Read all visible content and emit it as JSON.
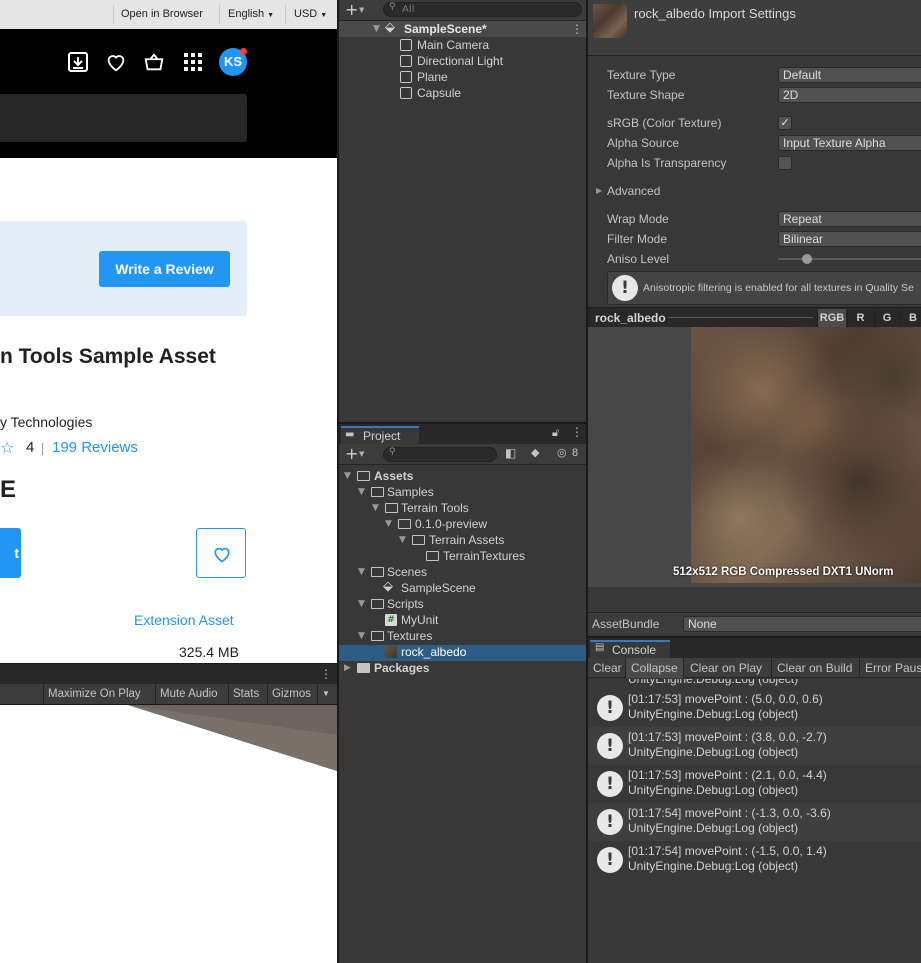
{
  "store": {
    "topbar": {
      "open_in_browser": "Open in Browser",
      "language": "English",
      "currency": "USD"
    },
    "avatar_initials": "KS",
    "review_button": "Write a Review",
    "asset_title": "n Tools Sample Asset",
    "publisher": "y Technologies",
    "star": "☆",
    "rating": "4",
    "reviews": "199 Reviews",
    "price": "E",
    "add_button": "t",
    "extension_asset": "Extension Asset",
    "file_size": "325.4 MB"
  },
  "game_view": {
    "toolbar": {
      "maximize": "Maximize On Play",
      "mute": "Mute Audio",
      "stats": "Stats",
      "gizmos": "Gizmos"
    }
  },
  "hierarchy": {
    "search_placeholder": "All",
    "scene": "SampleScene*",
    "items": [
      "Main Camera",
      "Directional Light",
      "Plane",
      "Capsule"
    ]
  },
  "project": {
    "tab_label": "Project",
    "hidden_count": "8",
    "tree": {
      "assets": "Assets",
      "samples": "Samples",
      "terrain_tools": "Terrain Tools",
      "version": "0.1.0-preview",
      "terrain_assets": "Terrain Assets",
      "terrain_textures": "TerrainTextures",
      "scenes": "Scenes",
      "sample_scene": "SampleScene",
      "scripts": "Scripts",
      "my_unit": "MyUnit",
      "textures": "Textures",
      "rock_albedo": "rock_albedo",
      "packages": "Packages"
    }
  },
  "inspector": {
    "title": "rock_albedo Import Settings",
    "props": {
      "texture_type_label": "Texture Type",
      "texture_type_value": "Default",
      "texture_shape_label": "Texture Shape",
      "texture_shape_value": "2D",
      "srgb_label": "sRGB (Color Texture)",
      "srgb_check": "✓",
      "alpha_source_label": "Alpha Source",
      "alpha_source_value": "Input Texture Alpha",
      "alpha_transp_label": "Alpha Is Transparency",
      "advanced_label": "Advanced",
      "wrap_mode_label": "Wrap Mode",
      "wrap_mode_value": "Repeat",
      "filter_mode_label": "Filter Mode",
      "filter_mode_value": "Bilinear",
      "aniso_label": "Aniso Level",
      "aniso_level": 1
    },
    "help_text": "Anisotropic filtering is enabled for all textures in Quality Se",
    "preview": {
      "name": "rock_albedo",
      "channels": [
        "RGB",
        "R",
        "G",
        "B"
      ],
      "info": "512x512  RGB Compressed DXT1 UNorm"
    },
    "assetbundle_label": "AssetBundle",
    "assetbundle_value": "None"
  },
  "console": {
    "tab_label": "Console",
    "toolbar": {
      "clear": "Clear",
      "collapse": "Collapse",
      "clear_on_play": "Clear on Play",
      "clear_on_build": "Clear on Build",
      "error_pause": "Error Paus"
    },
    "partial_top": "UnityEngine.Debug:Log (object)",
    "logs": [
      {
        "msg": "[01:17:53] movePoint : (5.0, 0.0, 0.6)",
        "src": "UnityEngine.Debug:Log (object)"
      },
      {
        "msg": "[01:17:53] movePoint : (3.8, 0.0, -2.7)",
        "src": "UnityEngine.Debug:Log (object)"
      },
      {
        "msg": "[01:17:53] movePoint : (2.1, 0.0, -4.4)",
        "src": "UnityEngine.Debug:Log (object)"
      },
      {
        "msg": "[01:17:54] movePoint : (-1.3, 0.0, -3.6)",
        "src": "UnityEngine.Debug:Log (object)"
      },
      {
        "msg": "[01:17:54] movePoint : (-1.5, 0.0, 1.4)",
        "src": "UnityEngine.Debug:Log (object)"
      }
    ]
  }
}
